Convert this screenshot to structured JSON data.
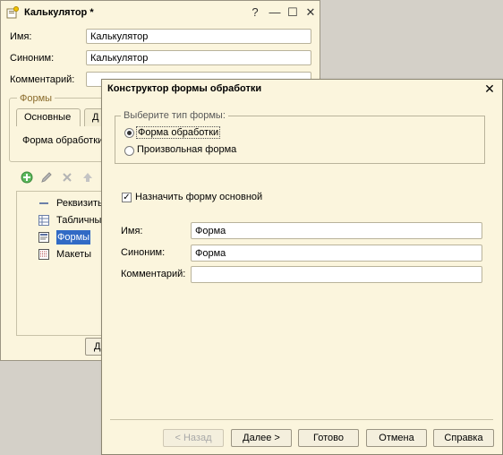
{
  "back_window": {
    "title": "Калькулятор *",
    "fields": {
      "name_label": "Имя:",
      "name_value": "Калькулятор",
      "synonym_label": "Синоним:",
      "synonym_value": "Калькулятор",
      "comment_label": "Комментарий:",
      "comment_value": ""
    },
    "group_label": "Формы",
    "tabs": [
      "Основные",
      "Д"
    ],
    "tab_content_text": "Форма обработки",
    "tree_items": [
      "Реквизиты",
      "Табличные",
      "Формы",
      "Макеты"
    ],
    "bottom_button": "Д"
  },
  "dialog": {
    "title": "Конструктор формы обработки",
    "form_type": {
      "legend": "Выберите тип формы:",
      "options": [
        "Форма обработки",
        "Произвольная форма"
      ],
      "selected_index": 0
    },
    "main_form_checkbox": {
      "label": "Назначить форму основной",
      "checked": true
    },
    "fields": {
      "name_label": "Имя:",
      "name_value": "Форма",
      "synonym_label": "Синоним:",
      "synonym_value": "Форма",
      "comment_label": "Комментарий:",
      "comment_value": ""
    },
    "buttons": {
      "back": "< Назад",
      "next": "Далее >",
      "done": "Готово",
      "cancel": "Отмена",
      "help": "Справка"
    }
  },
  "colors": {
    "window_bg": "#fbf5dd",
    "desktop_bg": "#d4d0c8",
    "legend_text": "#5a5a5a"
  }
}
